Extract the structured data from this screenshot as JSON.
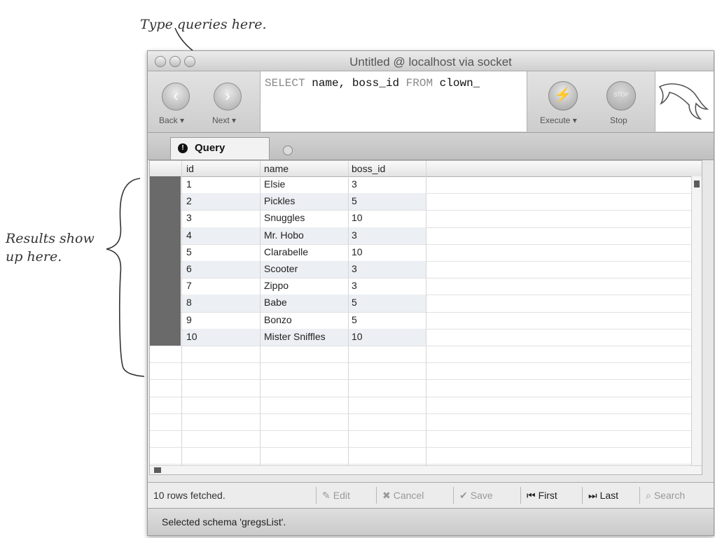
{
  "annotations": {
    "top": "Type queries here.",
    "left": "Results show up here."
  },
  "window": {
    "title": "Untitled @ localhost via socket"
  },
  "toolbar": {
    "back_label": "Back ▾",
    "next_label": "Next ▾",
    "query_keyword_select": "SELECT",
    "query_fields": "name, boss_id",
    "query_keyword_from": "FROM",
    "query_table": "clown_",
    "execute_label": "Execute ▾",
    "stop_label": "Stop",
    "stop_icon_text": "STOP"
  },
  "tabs": [
    {
      "label": "Query"
    }
  ],
  "grid": {
    "columns": [
      "id",
      "name",
      "boss_id"
    ],
    "rows": [
      [
        "1",
        "Elsie",
        "3"
      ],
      [
        "2",
        "Pickles",
        "5"
      ],
      [
        "3",
        "Snuggles",
        "10"
      ],
      [
        "4",
        "Mr. Hobo",
        "3"
      ],
      [
        "5",
        "Clarabelle",
        "10"
      ],
      [
        "6",
        "Scooter",
        "3"
      ],
      [
        "7",
        "Zippo",
        "3"
      ],
      [
        "8",
        "Babe",
        "5"
      ],
      [
        "9",
        "Bonzo",
        "5"
      ],
      [
        "10",
        "Mister Sniffles",
        "10"
      ]
    ]
  },
  "status": {
    "rows_fetched": "10 rows fetched.",
    "edit": "Edit",
    "cancel": "Cancel",
    "save": "Save",
    "first": "First",
    "last": "Last",
    "search": "Search",
    "schema": "Selected schema 'gregsList'."
  },
  "colors": {
    "row_handle": "#6a6a6a",
    "alt_row": "#eceff3"
  }
}
